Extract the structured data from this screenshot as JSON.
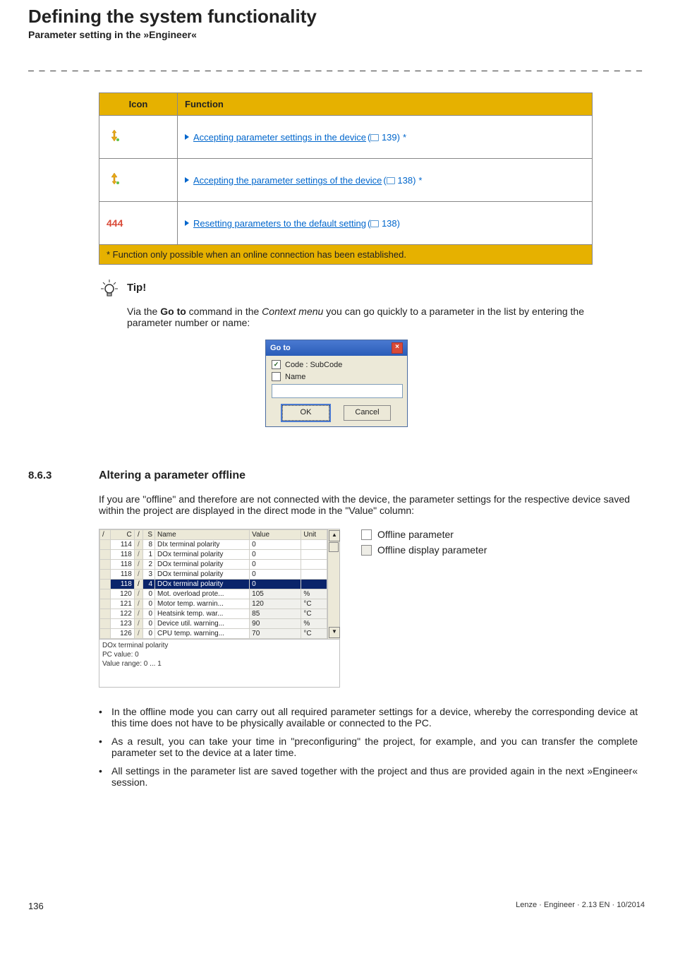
{
  "header": {
    "title": "Defining the system functionality",
    "subtitle": "Parameter setting in the »Engineer«",
    "dashes": "_ _ _ _ _ _ _ _ _ _ _ _ _ _ _ _ _ _ _ _ _ _ _ _ _ _ _ _ _ _ _ _ _ _ _ _ _ _ _ _ _ _ _ _ _ _ _ _ _ _ _ _ _ _ _ _ _ _ _ _ _ _ _ _"
  },
  "iconTable": {
    "headers": {
      "icon": "Icon",
      "function": "Function"
    },
    "rows": [
      {
        "link": "Accepting parameter settings in the device",
        "ref": "139",
        "star": true
      },
      {
        "link": "Accepting the parameter settings of the device",
        "ref": "138",
        "star": true
      },
      {
        "link": "Resetting parameters to the default setting",
        "ref": "138",
        "star": false
      }
    ],
    "footnote": "* Function only possible when an online connection has been established."
  },
  "tip": {
    "label": "Tip!",
    "body_pre": "Via the ",
    "body_bold": "Go to",
    "body_mid": " command in the ",
    "body_italic": "Context menu",
    "body_post": " you can go quickly to a parameter in the list by entering the parameter number or name:"
  },
  "gotoDialog": {
    "title": "Go to",
    "opt_code": "Code : SubCode",
    "opt_name": "Name",
    "btn_ok": "OK",
    "btn_cancel": "Cancel"
  },
  "section": {
    "num": "8.6.3",
    "title": "Altering a parameter offline",
    "intro": "If you are \"offline\" and therefore are not connected with the device, the parameter settings for the respective device saved within the project are displayed in the direct mode in the \"Value\" column:"
  },
  "paramGrid": {
    "headers": {
      "c": "C",
      "s": "S",
      "name": "Name",
      "value": "Value",
      "unit": "Unit"
    },
    "rows": [
      {
        "c": "114",
        "s": "8",
        "name": "DIx terminal polarity",
        "value": "0",
        "unit": "",
        "readonly": false
      },
      {
        "c": "118",
        "s": "1",
        "name": "DOx terminal polarity",
        "value": "0",
        "unit": "",
        "readonly": false
      },
      {
        "c": "118",
        "s": "2",
        "name": "DOx terminal polarity",
        "value": "0",
        "unit": "",
        "readonly": false
      },
      {
        "c": "118",
        "s": "3",
        "name": "DOx terminal polarity",
        "value": "0",
        "unit": "",
        "readonly": false
      },
      {
        "c": "118",
        "s": "4",
        "name": "DOx terminal polarity",
        "value": "0",
        "unit": "",
        "readonly": false,
        "selected": true
      },
      {
        "c": "120",
        "s": "0",
        "name": "Mot. overload prote...",
        "value": "105",
        "unit": "%",
        "readonly": true
      },
      {
        "c": "121",
        "s": "0",
        "name": "Motor temp. warnin...",
        "value": "120",
        "unit": "°C",
        "readonly": true
      },
      {
        "c": "122",
        "s": "0",
        "name": "Heatsink temp. war...",
        "value": "85",
        "unit": "°C",
        "readonly": true
      },
      {
        "c": "123",
        "s": "0",
        "name": "Device util. warning...",
        "value": "90",
        "unit": "%",
        "readonly": true
      },
      {
        "c": "126",
        "s": "0",
        "name": "CPU temp. warning...",
        "value": "70",
        "unit": "°C",
        "readonly": true
      }
    ],
    "footer": {
      "line1": "DOx terminal polarity",
      "line2": "PC value: 0",
      "line3": "Value range: 0 ... 1"
    }
  },
  "legend": {
    "offline_param": "Offline parameter",
    "offline_display": "Offline display parameter"
  },
  "bullets": [
    "In the offline mode you can carry out all required parameter settings for a device, whereby the corresponding device at this time does not have to be physically available or connected to the PC.",
    "As a result, you can take your time in \"preconfiguring\" the project, for example, and you can transfer the complete parameter set to the device at a later time.",
    "All settings in the parameter list are saved together with the project and thus are provided again in the next »Engineer« session."
  ],
  "footer": {
    "page": "136",
    "info": "Lenze · Engineer · 2.13 EN · 10/2014"
  }
}
